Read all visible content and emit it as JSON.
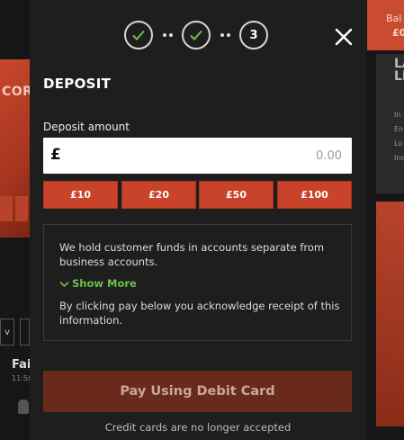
{
  "background": {
    "left_promo_text": "CORI",
    "left_button_text": "v",
    "left_name": "Fai",
    "left_time": "11:5(",
    "right_balance_label": "Bal",
    "right_balance_value": "£0",
    "right_card_title": "LA\nLE",
    "right_card_lines": "In\nEn\nLo\nInd"
  },
  "stepper": {
    "step1_icon": "check-icon",
    "step2_icon": "check-icon",
    "step3_label": "3",
    "colors": {
      "check": "#6cc04a",
      "ring": "#d6d6d6"
    }
  },
  "modal": {
    "close_icon": "close-icon",
    "title": "DEPOSIT",
    "amount_label": "Deposit amount",
    "currency_symbol": "£",
    "amount_placeholder": "0.00",
    "quick_amounts": [
      "£10",
      "£20",
      "£50",
      "£100"
    ],
    "info_text": "We hold customer funds in accounts separate from business accounts.",
    "show_more_label": "Show More",
    "acknowledge_text": "By clicking pay below you acknowledge receipt of this information.",
    "pay_button_label": "Pay Using Debit Card",
    "credit_note": "Credit cards are no longer accepted"
  },
  "colors": {
    "accent": "#c9432a",
    "pay_disabled": "#6a2a1b",
    "link_green": "#6cc04a",
    "modal_bg": "#1e1e1e"
  }
}
